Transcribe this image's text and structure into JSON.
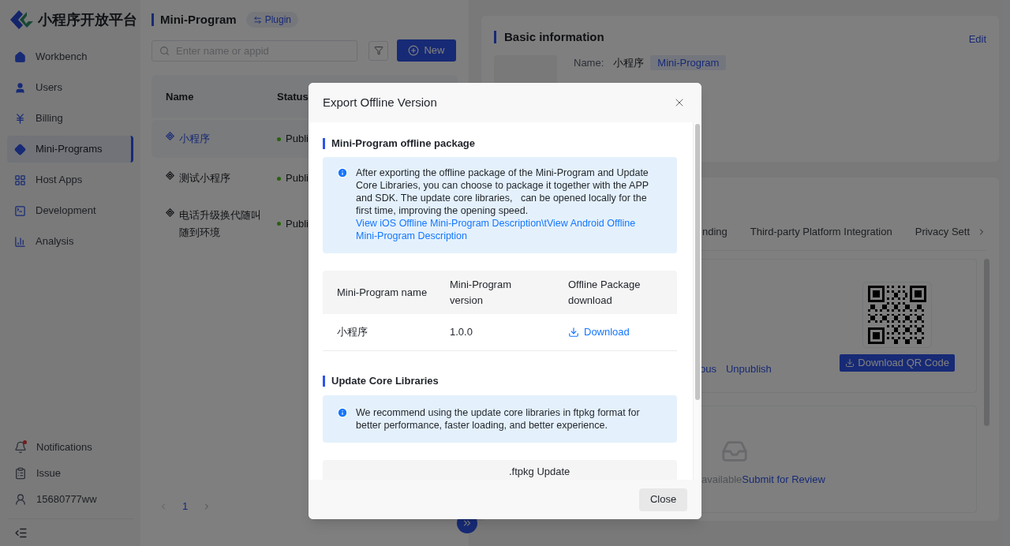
{
  "brand": {
    "name": "小程序开放平台"
  },
  "sidebar": {
    "items": [
      {
        "label": "Workbench",
        "selected": false
      },
      {
        "label": "Users",
        "selected": false
      },
      {
        "label": "Billing",
        "selected": false
      },
      {
        "label": "Mini-Programs",
        "selected": true
      },
      {
        "label": "Host Apps",
        "selected": false
      },
      {
        "label": "Development",
        "selected": false
      },
      {
        "label": "Analysis",
        "selected": false
      }
    ],
    "footer_items": [
      {
        "label": "Notifications",
        "badge": true
      },
      {
        "label": "Issue",
        "badge": false
      },
      {
        "label": "15680777ww",
        "badge": false
      }
    ]
  },
  "list_panel": {
    "title": "Mini-Program",
    "switch_label": "Plugin",
    "search": {
      "placeholder": "Enter name or appid"
    },
    "new_button": "New",
    "columns": [
      "Name",
      "Status"
    ],
    "rows": [
      {
        "name": "小程序",
        "status": "Publi",
        "color": "#29620d",
        "selected": true
      },
      {
        "name": "测试小程序",
        "status": "Publi",
        "color": "#29620d",
        "selected": false
      },
      {
        "name": "电话升级换代随叫随到环境",
        "status": "Publi",
        "color": "#29620d",
        "selected": false
      }
    ],
    "pagination": {
      "pages": [
        {
          "label": "1",
          "selected": true
        }
      ]
    }
  },
  "detail": {
    "basic_info": {
      "title": "Basic information",
      "edit": "Edit",
      "name_label": "Name:",
      "name": "小程序",
      "type_tag": "Mini-Program"
    },
    "tabs": [
      {
        "label": "nding",
        "selected": false
      },
      {
        "label": "Third-party Platform Integration",
        "selected": false
      },
      {
        "label": "Privacy Sett",
        "selected": false
      }
    ],
    "version_card": {
      "actions": [
        "ous",
        "Unpublish"
      ],
      "qr_button": "Download QR Code"
    },
    "review_card": {
      "status": "available",
      "action": "Submit for Review"
    }
  },
  "dialog": {
    "title": "Export Offline Version",
    "sections": [
      {
        "title": "Mini-Program offline package",
        "notice": "After exporting the offline package of the Mini-Program and Update Core Libraries, you can choose to package it together with the APP and SDK. The update core libraries,   can be opened locally for the first time, improving the opening speed.",
        "notice_link": "View iOS Offline Mini-Program Description\\tView Android Offline Mini-Program Description",
        "table": {
          "columns": [
            "Mini-Program name",
            "Mini-Program version",
            "Offline Package download"
          ],
          "rows": [
            {
              "name": "小程序",
              "version": "1.0.0",
              "action": "Download"
            }
          ]
        }
      },
      {
        "title": "Update Core Libraries",
        "notice": "We recommend using the update core libraries in ftpkg format for better performance, faster loading, and better experience.",
        "table": {
          "header": {
            "column_2": ".ftpkg Update"
          }
        }
      }
    ],
    "close_button": "Close"
  }
}
